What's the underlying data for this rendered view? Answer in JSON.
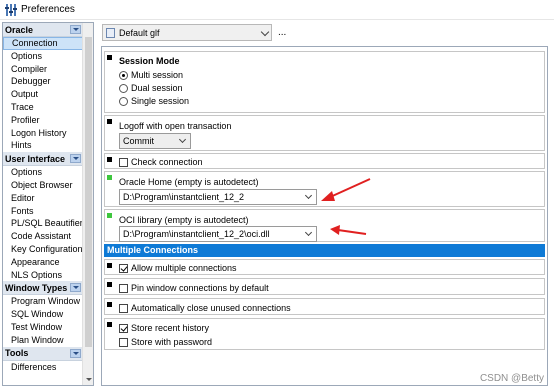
{
  "window": {
    "title": "Preferences"
  },
  "sidebar": {
    "groups": [
      {
        "label": "Oracle",
        "items": [
          {
            "label": "Connection",
            "selected": true
          },
          {
            "label": "Options"
          },
          {
            "label": "Compiler"
          },
          {
            "label": "Debugger"
          },
          {
            "label": "Output"
          },
          {
            "label": "Trace"
          },
          {
            "label": "Profiler"
          },
          {
            "label": "Logon History"
          },
          {
            "label": "Hints"
          }
        ]
      },
      {
        "label": "User Interface",
        "items": [
          {
            "label": "Options"
          },
          {
            "label": "Object Browser"
          },
          {
            "label": "Editor"
          },
          {
            "label": "Fonts"
          },
          {
            "label": "PL/SQL Beautifier"
          },
          {
            "label": "Code Assistant"
          },
          {
            "label": "Key Configuration"
          },
          {
            "label": "Appearance"
          },
          {
            "label": "NLS Options"
          }
        ]
      },
      {
        "label": "Window Types",
        "items": [
          {
            "label": "Program Window"
          },
          {
            "label": "SQL Window"
          },
          {
            "label": "Test Window"
          },
          {
            "label": "Plan Window"
          }
        ]
      },
      {
        "label": "Tools",
        "items": [
          {
            "label": "Differences"
          }
        ]
      }
    ]
  },
  "profile": {
    "value": "Default glf",
    "more": "..."
  },
  "session_mode": {
    "title": "Session Mode",
    "options": [
      "Multi session",
      "Dual session",
      "Single session"
    ],
    "selected": "Multi session"
  },
  "logoff": {
    "label": "Logoff with open transaction",
    "value": "Commit"
  },
  "check_connection": {
    "label": "Check connection",
    "checked": false
  },
  "oracle_home": {
    "label": "Oracle Home (empty is autodetect)",
    "value": "D:\\Program\\instantclient_12_2"
  },
  "oci_library": {
    "label": "OCI library (empty is autodetect)",
    "value": "D:\\Program\\instantclient_12_2\\oci.dll"
  },
  "multiple_connections": {
    "header": "Multiple Connections",
    "allow": {
      "label": "Allow multiple connections",
      "checked": true
    },
    "pin": {
      "label": "Pin window connections by default",
      "checked": false
    },
    "auto_close": {
      "label": "Automatically close unused connections",
      "checked": false
    },
    "store_recent": {
      "label": "Store recent history",
      "checked": true
    },
    "store_password": {
      "label": "Store with password",
      "checked": false
    }
  },
  "watermark": "CSDN @Betty",
  "colors": {
    "accent": "#0e7ad6",
    "annotation_arrow": "#e02020",
    "indicator_green": "#3ec63e"
  }
}
